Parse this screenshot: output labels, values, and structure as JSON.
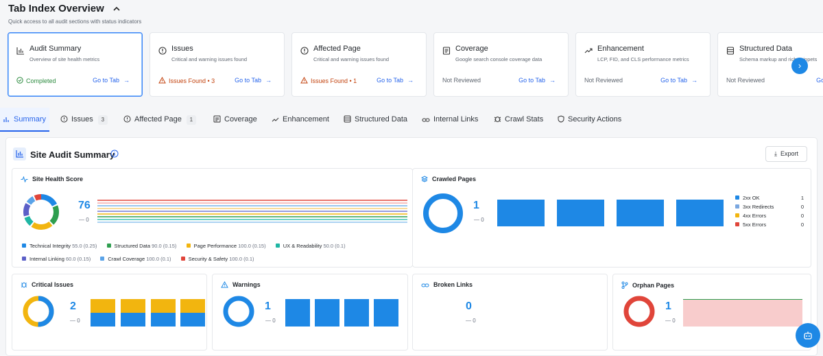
{
  "header": {
    "title": "Tab Index Overview",
    "subtitle": "Quick access to all audit sections with status indicators"
  },
  "cards": [
    {
      "title": "Audit Summary",
      "desc": "Overview of site health metrics",
      "status": "Completed",
      "link": "Go to Tab",
      "icon": "bar-chart-icon"
    },
    {
      "title": "Issues",
      "desc": "Critical and warning issues found",
      "status": "Issues Found • 3",
      "link": "Go to Tab",
      "icon": "alert-circle-icon"
    },
    {
      "title": "Affected Page",
      "desc": "Critical and warning issues found",
      "status": "Issues Found • 1",
      "link": "Go to Tab",
      "icon": "alert-circle-icon"
    },
    {
      "title": "Coverage",
      "desc": "Google search console coverage data",
      "status": "Not Reviewed",
      "link": "Go to Tab",
      "icon": "document-icon"
    },
    {
      "title": "Enhancement",
      "desc": "LCP, FID, and CLS performance metrics",
      "status": "Not Reviewed",
      "link": "Go to Tab",
      "icon": "trend-up-icon"
    },
    {
      "title": "Structured Data",
      "desc": "Schema markup and rich snippets",
      "status": "Not Reviewed",
      "link": "Go to Tab",
      "icon": "database-icon"
    }
  ],
  "tabs": [
    {
      "label": "Summary"
    },
    {
      "label": "Issues",
      "badge": "3"
    },
    {
      "label": "Affected Page",
      "badge": "1"
    },
    {
      "label": "Coverage"
    },
    {
      "label": "Enhancement"
    },
    {
      "label": "Structured Data"
    },
    {
      "label": "Internal Links"
    },
    {
      "label": "Crawl Stats"
    },
    {
      "label": "Security Actions"
    }
  ],
  "summary": {
    "title": "Site Audit Summary",
    "export_label": "Export",
    "health": {
      "title": "Site Health Score",
      "score": "76",
      "delta": "— 0",
      "legend": [
        {
          "name": "Technical Integrity",
          "value": "55.0 (0.25)",
          "color": "#1e88e5"
        },
        {
          "name": "Structured Data",
          "value": "90.0 (0.15)",
          "color": "#2e9e4f"
        },
        {
          "name": "Page Performance",
          "value": "100.0 (0.15)",
          "color": "#f2b50f"
        },
        {
          "name": "UX & Readability",
          "value": "50.0 (0.1)",
          "color": "#1fb6a4"
        },
        {
          "name": "Internal Linking",
          "value": "60.0 (0.15)",
          "color": "#5b5fc7"
        },
        {
          "name": "Crawl Coverage",
          "value": "100.0 (0.1)",
          "color": "#5aa3e8"
        },
        {
          "name": "Security & Safety",
          "value": "100.0 (0.1)",
          "color": "#e0453a"
        }
      ]
    },
    "crawled": {
      "title": "Crawled Pages",
      "value": "1",
      "delta": "— 0",
      "legend": [
        {
          "name": "2xx OK",
          "value": "1",
          "color": "#1e88e5"
        },
        {
          "name": "3xx Redirects",
          "value": "0",
          "color": "#7aa7e0"
        },
        {
          "name": "4xx Errors",
          "value": "0",
          "color": "#f2b50f"
        },
        {
          "name": "5xx Errors",
          "value": "0",
          "color": "#e0453a"
        }
      ]
    },
    "critical": {
      "title": "Critical Issues",
      "value": "2",
      "delta": "— 0"
    },
    "warnings": {
      "title": "Warnings",
      "value": "1",
      "delta": "— 0"
    },
    "broken": {
      "title": "Broken Links",
      "value": "0",
      "delta": "— 0"
    },
    "orphan": {
      "title": "Orphan Pages",
      "value": "1",
      "delta": "— 0"
    }
  },
  "colors": {
    "accent": "#1e88e5",
    "warning": "#f2b50f",
    "danger": "#e0453a",
    "success": "#2e9e4f"
  }
}
